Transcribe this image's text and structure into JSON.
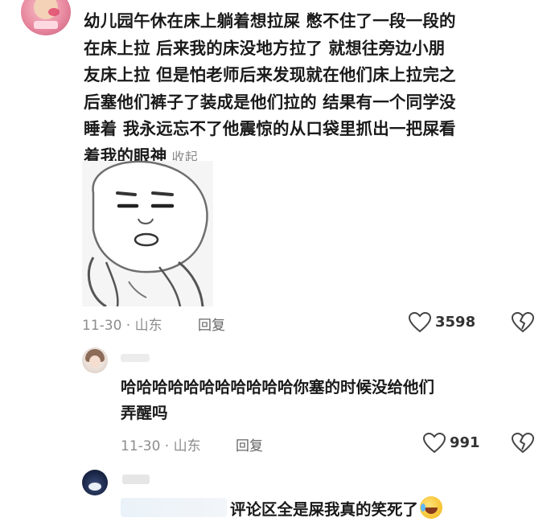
{
  "main_comment": {
    "lines": [
      "幼儿园午休在床上躺着想拉屎 憋不住了一段一段的",
      "在床上拉 后来我的床没地方拉了 就想往旁边小朋",
      "友床上拉 但是怕老师后来发现就在他们床上拉完之",
      "后塞他们裤子了装成是他们拉的 结果有一个同学没",
      "睡着 我永远忘不了他震惊的从口袋里抓出一把屎看",
      "着我的眼神"
    ],
    "collapse_label": "收起",
    "date": "11-30",
    "location": "山东",
    "reply_label": "回复",
    "likes": "3598"
  },
  "reply1": {
    "lines": [
      "哈哈哈哈哈哈哈哈哈哈哈你塞的时候没给他们",
      "弄醒吗"
    ],
    "date": "11-30",
    "location": "山东",
    "reply_label": "回复",
    "likes": "991"
  },
  "reply2": {
    "text": "评论区全是屎我真的笑死了",
    "emoji_icon": "rolling-laughing-emoji-icon"
  },
  "colors": {
    "text": "#1a1a1a",
    "meta": "#8c8c8c",
    "background": "#ffffff"
  }
}
